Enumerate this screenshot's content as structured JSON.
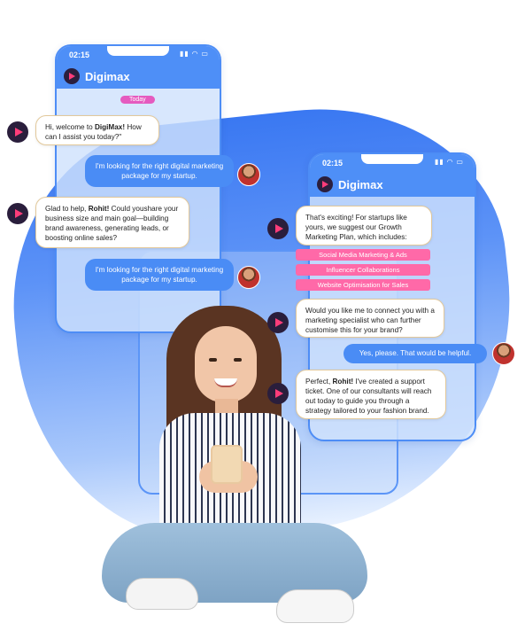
{
  "brand_name": "Digimax",
  "phone_left": {
    "time": "02:15",
    "today_label": "Today",
    "messages": [
      {
        "sender": "bot",
        "pre": "Hi, welcome to ",
        "bold": "DigiMax!",
        "post": " How can I assist you today?\""
      },
      {
        "sender": "user",
        "text": "I'm looking for the right digital marketing package for my startup."
      },
      {
        "sender": "bot",
        "pre": "Glad to help, ",
        "bold": "Rohit!",
        "post": " Could youshare your business size and main goal—building brand awareness, generating leads, or boosting online sales?"
      },
      {
        "sender": "user",
        "text": "I'm looking for the right digital marketing package for my startup."
      }
    ]
  },
  "phone_right": {
    "time": "02:15",
    "messages": [
      {
        "sender": "bot",
        "text": "That's exciting! For startups like yours, we suggest our Growth Marketing Plan, which includes:"
      },
      {
        "sender": "bot",
        "text": "Would you like me to connect you with a marketing specialist who can further customise this for your brand?"
      },
      {
        "sender": "user",
        "text": "Yes, please. That would be helpful."
      },
      {
        "sender": "bot",
        "pre": "Perfect, ",
        "bold": "Rohit!",
        "post": " I've created a support ticket. One of our consultants will reach out today to guide you through a strategy tailored to your fashion brand."
      }
    ],
    "options": [
      "Social Media Marketing & Ads",
      "Influencer Collaborations",
      "Website Optimisation for Sales"
    ]
  },
  "colors": {
    "accent": "#4e8ff7",
    "chip": "#ff69a8",
    "today": "#e55bbf",
    "bot_avatar": "#2a1e3c"
  },
  "icons": [
    "bot-avatar-icon",
    "user-avatar-icon",
    "signal-icon",
    "wifi-icon",
    "battery-icon",
    "location-arrow-icon"
  ]
}
